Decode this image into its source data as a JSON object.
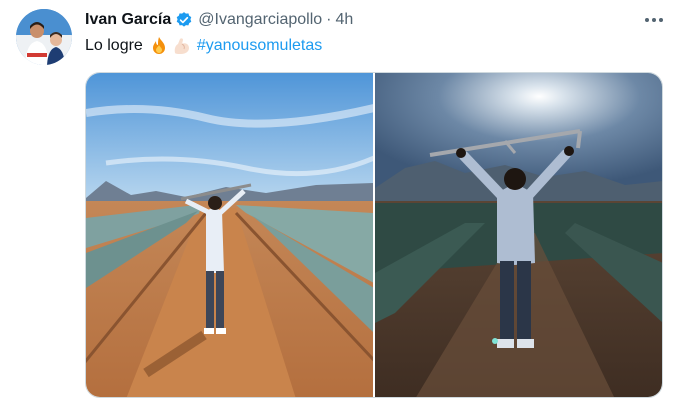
{
  "tweet": {
    "display_name": "Ivan García",
    "handle": "@Ivangarciapollo",
    "separator": "·",
    "time": "4h",
    "text": "Lo logre",
    "hashtag": "#yanousomuletas",
    "icons": {
      "verified": "verified-badge-icon",
      "more": "more-dots-icon",
      "emoji_1": "fire-emoji",
      "emoji_2": "flexed-biceps-emoji"
    },
    "colors": {
      "link": "#1d9bf0",
      "verified": "#1d9bf0",
      "text": "#0f1419",
      "secondary": "#536471"
    }
  }
}
